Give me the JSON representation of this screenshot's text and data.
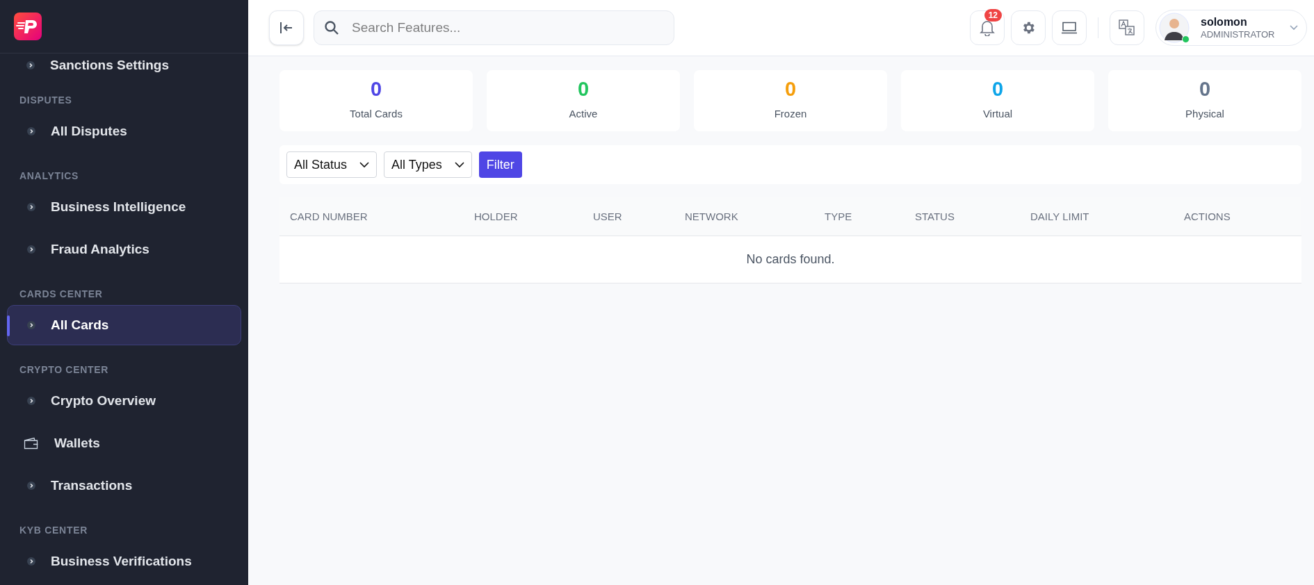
{
  "sidebar": {
    "partial_item": {
      "label": "Sanctions Settings",
      "kind": "chevron"
    },
    "sections": [
      {
        "label": "DISPUTES",
        "items": [
          {
            "label": "All Disputes",
            "kind": "chevron",
            "selected": false
          }
        ]
      },
      {
        "label": "ANALYTICS",
        "items": [
          {
            "label": "Business Intelligence",
            "kind": "chevron",
            "selected": false
          },
          {
            "label": "Fraud Analytics",
            "kind": "chevron",
            "selected": false
          }
        ]
      },
      {
        "label": "CARDS CENTER",
        "items": [
          {
            "label": "All Cards",
            "kind": "chevron",
            "selected": true
          }
        ]
      },
      {
        "label": "CRYPTO CENTER",
        "items": [
          {
            "label": "Crypto Overview",
            "kind": "chevron",
            "selected": false
          },
          {
            "label": "Wallets",
            "kind": "wallet",
            "selected": false
          },
          {
            "label": "Transactions",
            "kind": "chevron",
            "selected": false
          }
        ]
      },
      {
        "label": "KYB CENTER",
        "items": [
          {
            "label": "Business Verifications",
            "kind": "chevron",
            "selected": false
          }
        ]
      }
    ]
  },
  "header": {
    "search": {
      "placeholder": "Search Features..."
    },
    "notifications": {
      "count": "12"
    },
    "user": {
      "name": "solomon",
      "role": "ADMINISTRATOR"
    }
  },
  "stats": [
    {
      "value": "0",
      "label": "Total Cards",
      "color": "#4f46e5"
    },
    {
      "value": "0",
      "label": "Active",
      "color": "#22c55e"
    },
    {
      "value": "0",
      "label": "Frozen",
      "color": "#f59e0b"
    },
    {
      "value": "0",
      "label": "Virtual",
      "color": "#0ea5e9"
    },
    {
      "value": "0",
      "label": "Physical",
      "color": "#64748b"
    }
  ],
  "filters": {
    "selects": [
      {
        "value": "All Status"
      },
      {
        "value": "All Types"
      }
    ],
    "button": "Filter"
  },
  "table": {
    "columns": [
      "CARD NUMBER",
      "HOLDER",
      "USER",
      "NETWORK",
      "TYPE",
      "STATUS",
      "DAILY LIMIT",
      "ACTIONS"
    ],
    "empty_message": "No cards found."
  }
}
